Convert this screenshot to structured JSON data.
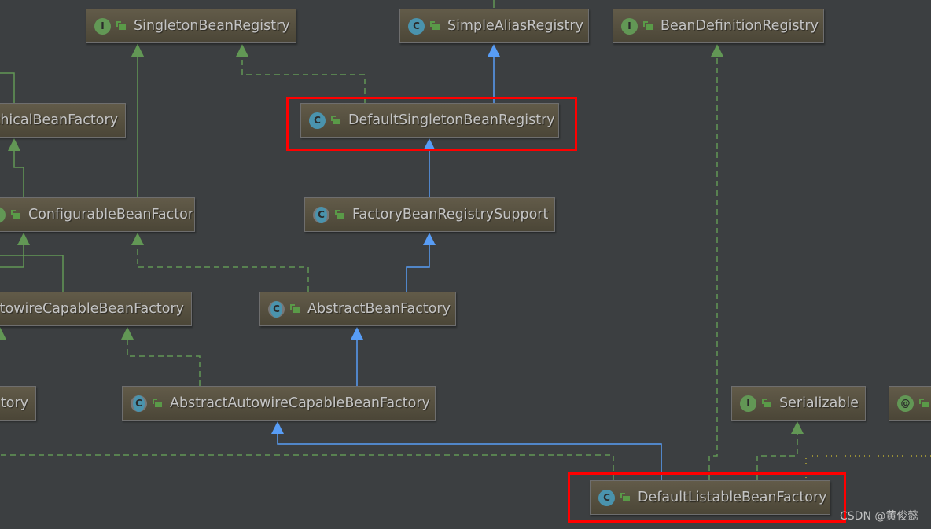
{
  "diagram": {
    "nodes": [
      {
        "id": "singleton-bean-registry",
        "name": "SingletonBeanRegistry",
        "kind": "interface",
        "icon_letter": "I"
      },
      {
        "id": "simple-alias-registry",
        "name": "SimpleAliasRegistry",
        "kind": "class",
        "icon_letter": "C"
      },
      {
        "id": "bean-definition-registry",
        "name": "BeanDefinitionRegistry",
        "kind": "interface",
        "icon_letter": "I"
      },
      {
        "id": "hierarchical-bean-factory",
        "name": "chicalBeanFactory",
        "kind": "interface",
        "icon_letter": "I"
      },
      {
        "id": "default-singleton-bean-registry",
        "name": "DefaultSingletonBeanRegistry",
        "kind": "class",
        "icon_letter": "C",
        "highlighted": true
      },
      {
        "id": "configurable-bean-factory",
        "name": "ConfigurableBeanFactory",
        "kind": "interface",
        "icon_letter": "I"
      },
      {
        "id": "factory-bean-registry-support",
        "name": "FactoryBeanRegistrySupport",
        "kind": "abstract",
        "icon_letter": "C"
      },
      {
        "id": "autowire-capable-bean-factory",
        "name": "utowireCapableBeanFactory",
        "kind": "interface",
        "icon_letter": "I"
      },
      {
        "id": "abstract-bean-factory",
        "name": "AbstractBeanFactory",
        "kind": "abstract",
        "icon_letter": "C"
      },
      {
        "id": "partial-factory",
        "name": "tory",
        "kind": "interface",
        "icon_letter": "I"
      },
      {
        "id": "abstract-autowire-capable-bean-factory",
        "name": "AbstractAutowireCapableBeanFactory",
        "kind": "abstract",
        "icon_letter": "C"
      },
      {
        "id": "serializable",
        "name": "Serializable",
        "kind": "interface",
        "icon_letter": "I"
      },
      {
        "id": "annotation-node",
        "name": "",
        "kind": "annotation",
        "icon_letter": "@"
      },
      {
        "id": "default-listable-bean-factory",
        "name": "DefaultListableBeanFactory",
        "kind": "class",
        "icon_letter": "C",
        "highlighted": true
      }
    ],
    "edge_colors": {
      "extends_class": "#589df6",
      "implements": "#629755",
      "extends_interface": "#629755",
      "highlight": "#ff0000"
    }
  },
  "watermark": "CSDN @黄俊懿"
}
